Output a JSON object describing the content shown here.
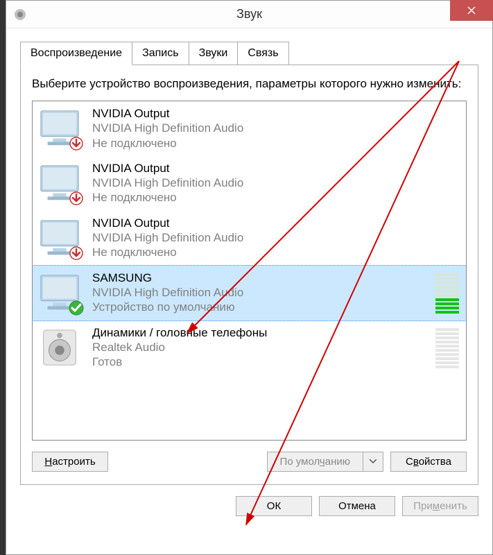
{
  "window": {
    "title": "Звук"
  },
  "tabs": {
    "playback": "Воспроизведение",
    "record": "Запись",
    "sounds": "Звуки",
    "comm": "Связь"
  },
  "instruction": "Выберите устройство воспроизведения, параметры которого нужно изменить:",
  "devices": [
    {
      "name": "NVIDIA Output",
      "driver": "NVIDIA High Definition Audio",
      "status": "Не подключено",
      "state": "disconnected"
    },
    {
      "name": "NVIDIA Output",
      "driver": "NVIDIA High Definition Audio",
      "status": "Не подключено",
      "state": "disconnected"
    },
    {
      "name": "NVIDIA Output",
      "driver": "NVIDIA High Definition Audio",
      "status": "Не подключено",
      "state": "disconnected"
    },
    {
      "name": "SAMSUNG",
      "driver": "NVIDIA High Definition Audio",
      "status": "Устройство по умолчанию",
      "state": "default",
      "selected": true,
      "level": 4
    },
    {
      "name": "Динамики / головные телефоны",
      "driver": "Realtek Audio",
      "status": "Готов",
      "state": "ready",
      "level": 0,
      "iconType": "speaker"
    }
  ],
  "buttons": {
    "configure": "Настроить",
    "default_label_pre": "По умол",
    "default_label_u": "ч",
    "default_label_post": "анию",
    "properties_pre": "С",
    "properties_u": "в",
    "properties_post": "ойства",
    "ok": "ОК",
    "cancel": "Отмена",
    "apply_pre": "При",
    "apply_u": "м",
    "apply_post": "енить"
  }
}
